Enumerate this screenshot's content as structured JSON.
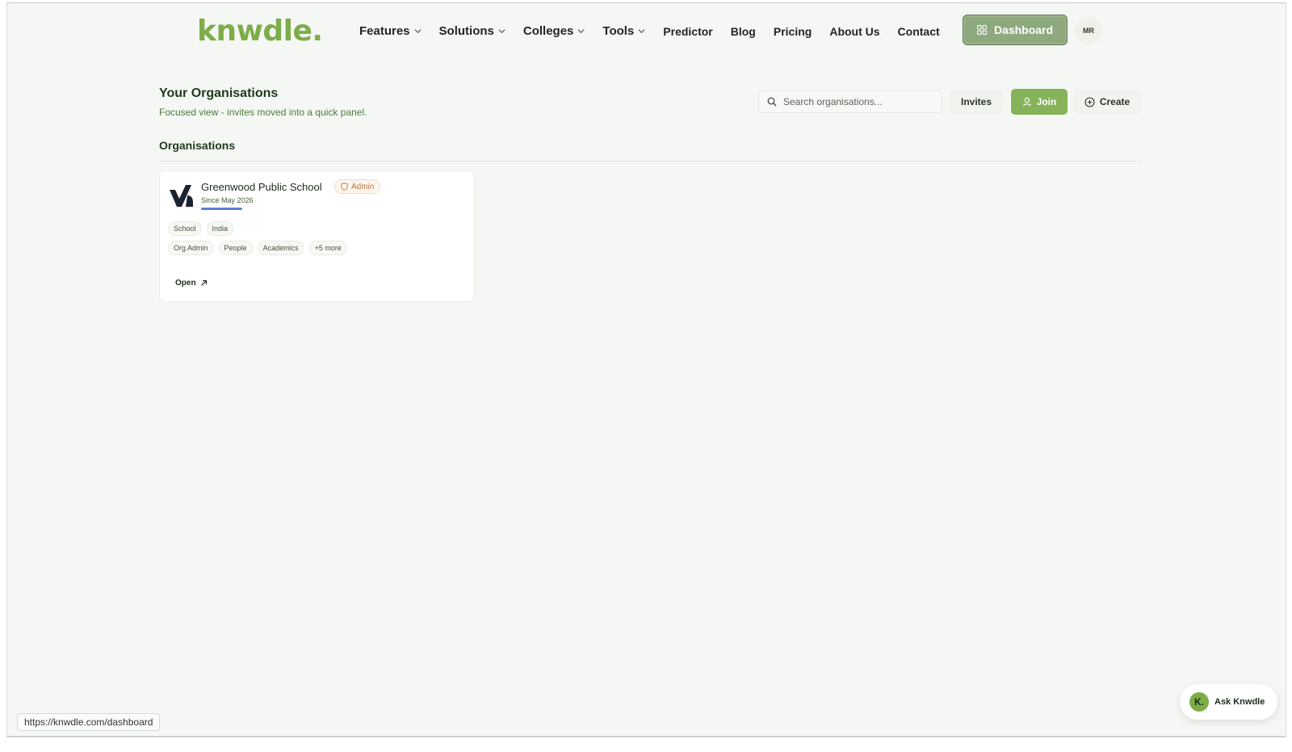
{
  "brand": {
    "logo": "knwdle."
  },
  "nav": {
    "items": [
      {
        "label": "Features",
        "dropdown": true
      },
      {
        "label": "Solutions",
        "dropdown": true
      },
      {
        "label": "Colleges",
        "dropdown": true
      },
      {
        "label": "Tools",
        "dropdown": true
      },
      {
        "label": "Predictor",
        "dropdown": false
      },
      {
        "label": "Blog",
        "dropdown": false
      },
      {
        "label": "Pricing",
        "dropdown": false
      },
      {
        "label": "About Us",
        "dropdown": false
      },
      {
        "label": "Contact",
        "dropdown": false
      }
    ],
    "dashboard_label": "Dashboard",
    "avatar_initials": "MR"
  },
  "header": {
    "title": "Your Organisations",
    "subtitle": "Focused view - invites moved into a quick panel.",
    "search_placeholder": "Search organisations...",
    "invites_label": "Invites",
    "join_label": "Join",
    "create_label": "Create"
  },
  "organisations": {
    "section_title": "Organisations",
    "cards": [
      {
        "name": "Greenwood Public School",
        "role_badge": "Admin",
        "since": "Since May 2026",
        "tags_row1": [
          "School",
          "India"
        ],
        "tags_row2": [
          "Org Admin",
          "People",
          "Academics",
          "+5 more"
        ],
        "open_label": "Open"
      }
    ]
  },
  "assistant": {
    "label": "Ask Knwdle",
    "logo_letter": "K."
  },
  "status_bar": {
    "url": "https://knwdle.com/dashboard"
  },
  "colors": {
    "brand_green": "#7cad48",
    "join_green": "#86b35a",
    "dashboard_btn": "#8fa97f",
    "admin_badge": "#c0733a",
    "accent_blue": "#5e7ed6"
  }
}
